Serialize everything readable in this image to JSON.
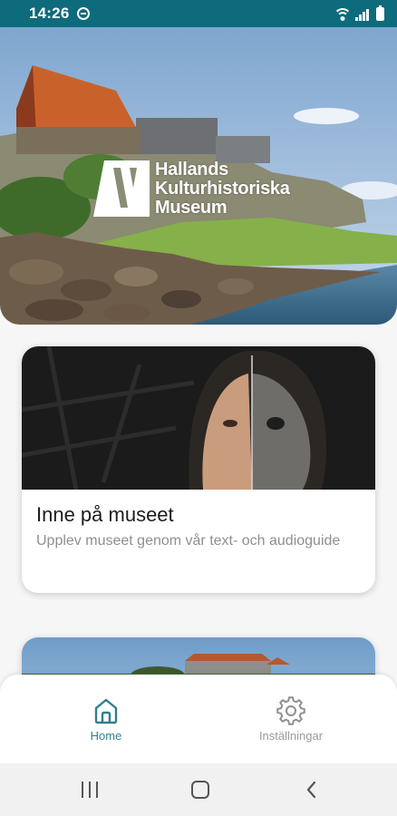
{
  "status_bar": {
    "time": "14:26",
    "icons": [
      "do-not-disturb-icon",
      "wifi-icon",
      "signal-icon",
      "battery-icon"
    ]
  },
  "hero": {
    "logo_lines": [
      "Hallands",
      "Kulturhistoriska",
      "Museum"
    ]
  },
  "cards": [
    {
      "title": "Inne på museet",
      "description": "Upplev museet genom vår text- och audioguide"
    }
  ],
  "bottom_nav": {
    "items": [
      {
        "label": "Home",
        "icon": "home-icon",
        "active": true
      },
      {
        "label": "Inställningar",
        "icon": "gear-icon",
        "active": false
      }
    ]
  },
  "system_nav": {
    "buttons": [
      "recents-icon",
      "home-circle-icon",
      "back-icon"
    ]
  },
  "colors": {
    "status_bar": "#0e6b7b",
    "accent": "#2f7f8e",
    "inactive": "#9a9a9a"
  }
}
